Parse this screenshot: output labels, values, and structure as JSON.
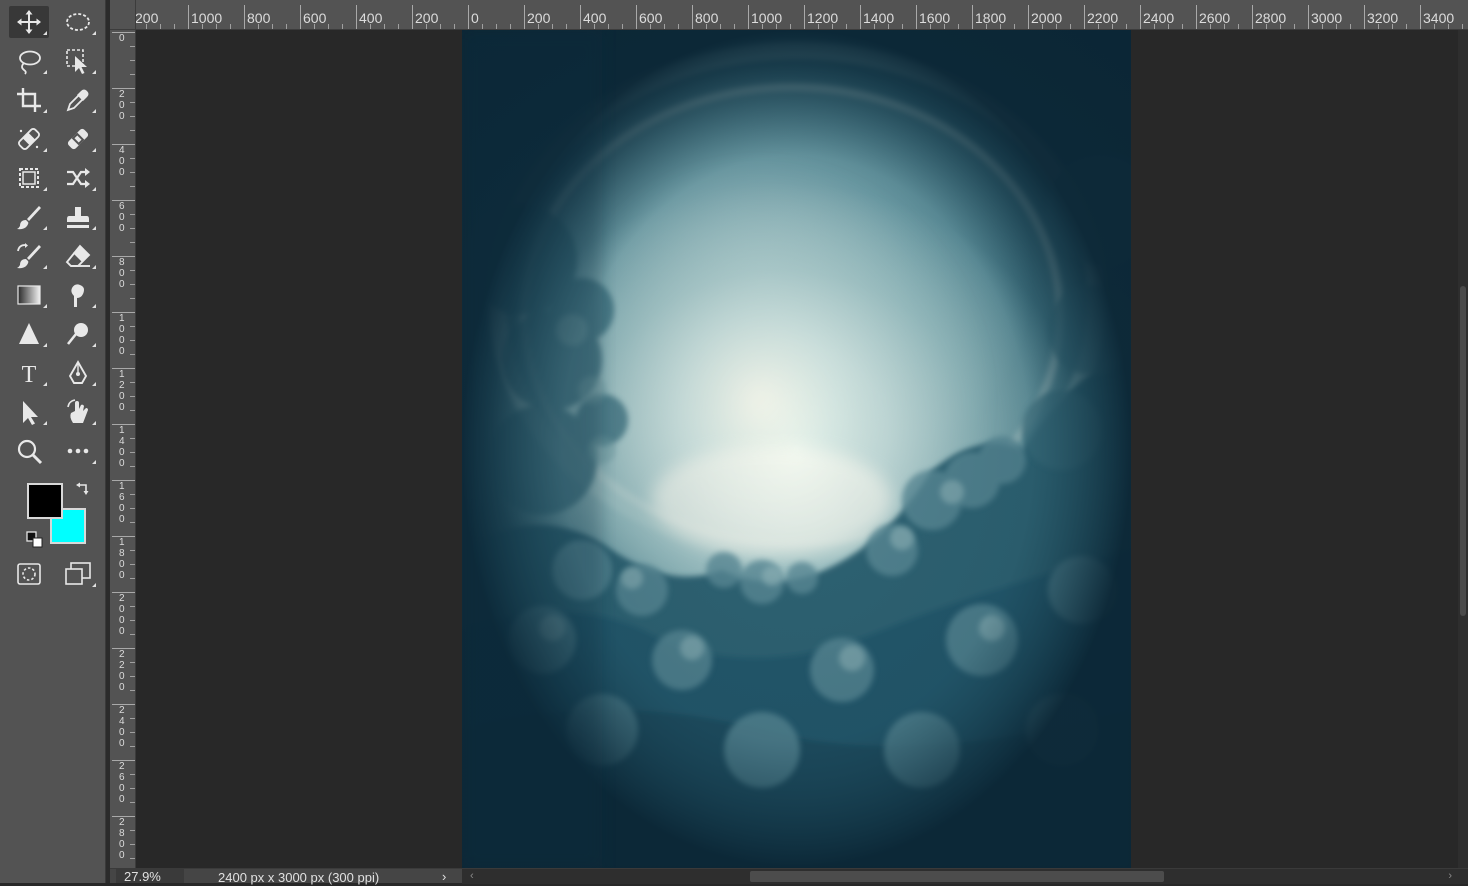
{
  "tools": [
    {
      "name": "move-tool",
      "icon": "move-icon",
      "active": true
    },
    {
      "name": "elliptical-marquee-tool",
      "icon": "elliptical-marquee-icon"
    },
    {
      "name": "lasso-tool",
      "icon": "lasso-icon"
    },
    {
      "name": "object-selection-tool",
      "icon": "object-selection-icon"
    },
    {
      "name": "crop-tool",
      "icon": "crop-icon"
    },
    {
      "name": "eyedropper-tool",
      "icon": "eyedropper-icon"
    },
    {
      "name": "spot-healing-brush-tool",
      "icon": "spot-healing-icon"
    },
    {
      "name": "healing-brush-tool",
      "icon": "healing-brush-icon"
    },
    {
      "name": "content-aware-move-tool",
      "icon": "content-aware-icon"
    },
    {
      "name": "shuffle-tool",
      "icon": "shuffle-icon"
    },
    {
      "name": "brush-tool",
      "icon": "brush-icon"
    },
    {
      "name": "clone-stamp-tool",
      "icon": "stamp-icon"
    },
    {
      "name": "history-brush-tool",
      "icon": "history-brush-icon"
    },
    {
      "name": "eraser-tool",
      "icon": "eraser-icon"
    },
    {
      "name": "gradient-tool",
      "icon": "gradient-icon"
    },
    {
      "name": "smudge-tool",
      "icon": "smudge-icon"
    },
    {
      "name": "sharpen-tool",
      "icon": "sharpen-icon"
    },
    {
      "name": "dodge-tool",
      "icon": "dodge-icon"
    },
    {
      "name": "type-tool",
      "icon": "type-icon"
    },
    {
      "name": "pen-tool",
      "icon": "pen-icon"
    },
    {
      "name": "path-selection-tool",
      "icon": "path-selection-icon"
    },
    {
      "name": "rotate-view-tool",
      "icon": "rotate-hand-icon"
    },
    {
      "name": "zoom-tool",
      "icon": "zoom-icon"
    },
    {
      "name": "more-tools",
      "icon": "ellipsis-icon"
    },
    {
      "name": "quick-mask-mode",
      "icon": "quick-mask-icon"
    },
    {
      "name": "screen-mode",
      "icon": "screen-mode-icon"
    }
  ],
  "colors": {
    "foreground": "#000000",
    "background": "#00ffff"
  },
  "ruler": {
    "horizontal": [
      "200",
      "1000",
      "800",
      "600",
      "400",
      "200",
      "0",
      "200",
      "400",
      "600",
      "800",
      "1000",
      "1200",
      "1400",
      "1600",
      "1800",
      "2000",
      "2200",
      "2400",
      "2600",
      "2800",
      "3000",
      "3200",
      "3400"
    ],
    "vertical": [
      "0",
      "200",
      "400",
      "600",
      "800",
      "1000",
      "1200",
      "1400",
      "1600",
      "1800",
      "2000",
      "2200",
      "2400",
      "2600",
      "2800"
    ]
  },
  "status": {
    "zoom": "27.9%",
    "doc_info": "2400 px x 3000 px (300 ppi)",
    "arrow": "›"
  }
}
